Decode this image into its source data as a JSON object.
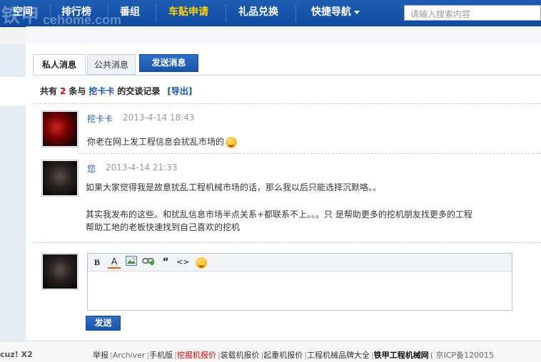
{
  "nav": {
    "watermark": "铁甲",
    "watermark_url": "cehome.com",
    "items": [
      {
        "label": "空间"
      },
      {
        "label": "排行榜"
      },
      {
        "label": "番组"
      },
      {
        "label": "车贴申请"
      },
      {
        "label": "礼品兑换"
      },
      {
        "label": "快捷导航"
      }
    ],
    "search_placeholder": "请输入搜索内容",
    "highlight_color": "#ffd200"
  },
  "tabs": {
    "private": "私人消息",
    "public": "公共消息",
    "send": "发送消息"
  },
  "summary": {
    "prefix": "共有",
    "count": "2",
    "middle": "条与",
    "user": "挖卡卡",
    "suffix": "的交谈记录",
    "export": "[导出]"
  },
  "messages": [
    {
      "author": "挖卡卡",
      "time": "2013-4-14 18:43",
      "lines": [
        "你老在网上发工程信息会扰乱市场的"
      ],
      "avatar_icon": "red-character-avatar"
    },
    {
      "author": "您",
      "time": "2013-4-14 21:33",
      "lines": [
        "如果大家觉得我是故意扰乱工程机械市场的话，那么我以后只能选择沉默咯。。",
        "",
        "其实我发布的这些。和扰乱信息市场半点关系+都联系不上。。。只 是帮助更多的挖机朋友找更多的工程",
        "帮助工地的老板快速找到自己喜欢的挖机"
      ],
      "avatar_icon": "dark-photo-avatar"
    }
  ],
  "editor": {
    "toolbar": [
      "bold-icon",
      "font-color-icon",
      "image-icon",
      "link-icon",
      "quote-icon",
      "code-icon",
      "emoticon-icon"
    ],
    "bold_glyph": "B",
    "color_glyph": "A",
    "quote_glyph": "“",
    "code_glyph": "<>",
    "send_label": "发送"
  },
  "footer": {
    "left": "cuz! X2",
    "links": [
      {
        "label": "举报"
      },
      {
        "label": "Archiver"
      },
      {
        "label": "手机版"
      },
      {
        "label": "挖掘机报价"
      },
      {
        "label": "装载机报价"
      },
      {
        "label": "起重机报价"
      },
      {
        "label": "工程机械品牌大全"
      },
      {
        "label": "铁甲工程机械网"
      },
      {
        "label": "( 京ICP备120015"
      }
    ]
  }
}
